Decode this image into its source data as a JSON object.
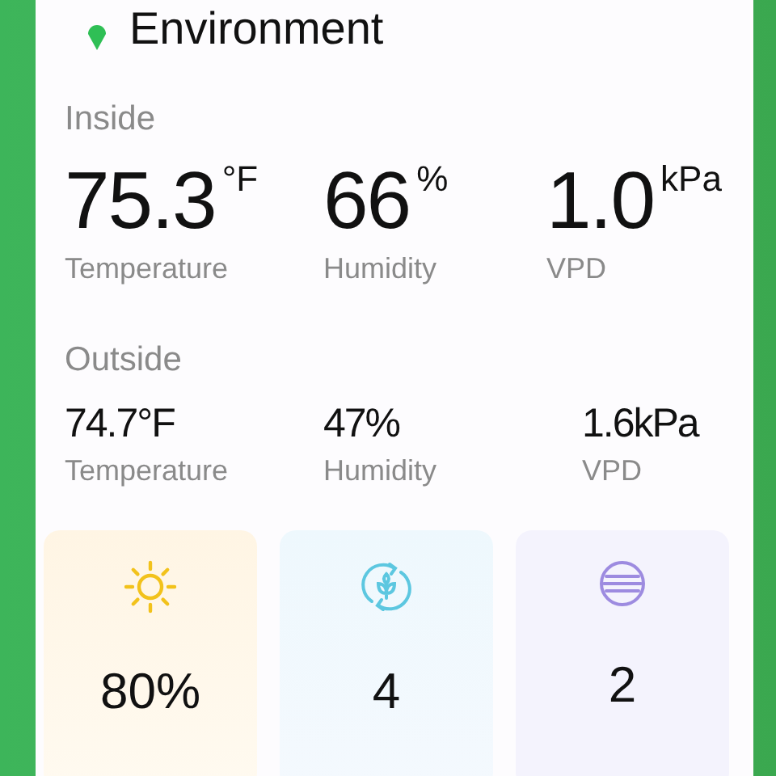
{
  "header": {
    "title": "Environment"
  },
  "inside": {
    "label": "Inside",
    "readings": [
      {
        "value": "75.3",
        "unit": "°F",
        "label": "Temperature"
      },
      {
        "value": "66",
        "unit": "%",
        "label": "Humidity"
      },
      {
        "value": "1.0",
        "unit": "kPa",
        "label": "VPD"
      }
    ]
  },
  "outside": {
    "label": "Outside",
    "readings": [
      {
        "value": "74.7°F",
        "label": "Temperature"
      },
      {
        "value": "47%",
        "label": "Humidity"
      },
      {
        "value": "1.6kPa",
        "label": "VPD"
      }
    ]
  },
  "tiles": [
    {
      "kind": "sun",
      "value": "80%"
    },
    {
      "kind": "cycle",
      "value": "4"
    },
    {
      "kind": "lines",
      "value": "2"
    }
  ]
}
